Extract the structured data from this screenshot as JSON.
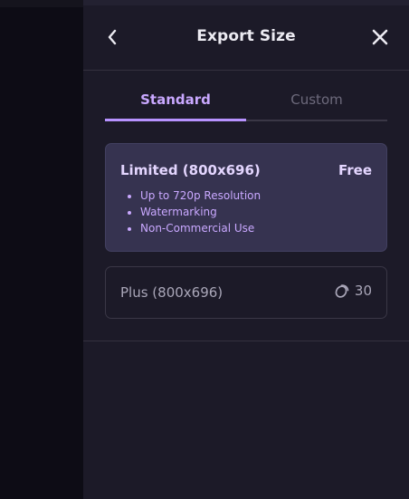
{
  "header": {
    "title": "Export Size",
    "back_icon": "chevron-left-icon",
    "close_icon": "close-icon"
  },
  "tabs": [
    {
      "label": "Standard",
      "active": true
    },
    {
      "label": "Custom",
      "active": false
    }
  ],
  "options": {
    "limited": {
      "title": "Limited (800x696)",
      "price": "Free",
      "features": [
        "Up to 720p Resolution",
        "Watermarking",
        "Non-Commercial Use"
      ],
      "selected": true
    },
    "plus": {
      "title": "Plus (800x696)",
      "cost": "30",
      "cost_icon": "credits-coin-icon",
      "selected": false
    }
  },
  "colors": {
    "accent": "#b792ff",
    "panel_bg": "#1c1a28",
    "selected_card_bg": "#363350"
  }
}
